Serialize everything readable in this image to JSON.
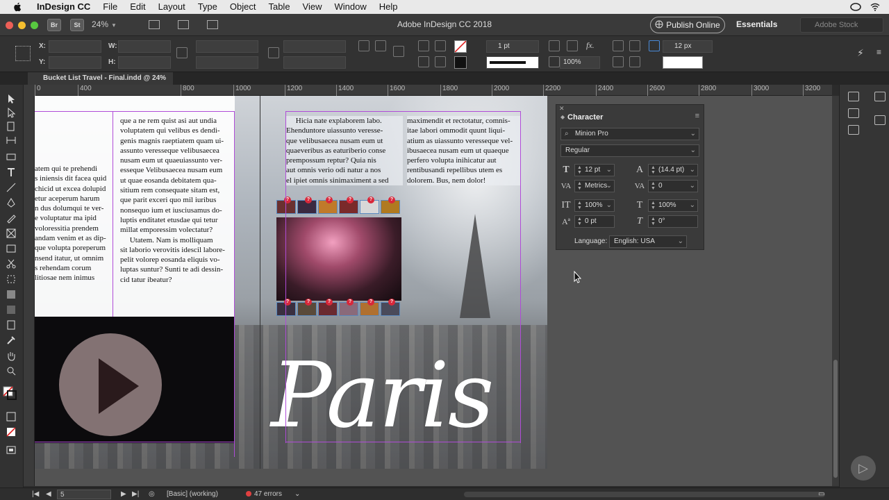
{
  "menubar": {
    "app_name": "InDesign CC",
    "items": [
      "File",
      "Edit",
      "Layout",
      "Type",
      "Object",
      "Table",
      "View",
      "Window",
      "Help"
    ]
  },
  "appbar": {
    "bridge_labels": [
      "Br",
      "St"
    ],
    "zoom": "24%",
    "title": "Adobe InDesign CC 2018",
    "publish_label": "Publish Online",
    "workspace": "Essentials",
    "stock_placeholder": "Adobe Stock"
  },
  "control_panel": {
    "x_label": "X:",
    "y_label": "Y:",
    "w_label": "W:",
    "h_label": "H:",
    "stroke_weight": "1 pt",
    "opacity": "100%",
    "gap": "12 px"
  },
  "document": {
    "tab_title": "Bucket List Travel - Final.indd @ 24%"
  },
  "ruler": {
    "ticks": [
      "0",
      "400",
      "800",
      "1000",
      "1200",
      "1400",
      "1600",
      "1800",
      "2000",
      "2200",
      "2400",
      "2600",
      "2800",
      "3000",
      "3200"
    ]
  },
  "page": {
    "left_col_a": "atem qui te prehendi\ns iniensis dit facea quid\nchicid ut excea dolupid\netur aceperum harum\nn dus dolumqui te ver-\ne voluptatur ma ipid\nvoloressitia prendem\nandam venim et as dip-\nque volupta poreperum\nnsend itatur, ut omnim\ns rehendam corum\nlitiosae nem inimus",
    "left_col_b": "que a ne rem quist asi aut undia\nvoluptatem qui velibus es dendi-\ngenis magnis raeptiatem quam ui-\nassunto veresseque velibusaecea\nnusam eum ut quaeuiassunto ver-\nesseque Velibusaecea nusam eum\nut quae eosanda debitatem qua-\nsitium rem consequate sitam est,\nque parit exceri quo mil iuribus\nnonsequo ium et iusciusamus do-\nluptis enditatet etusdae qui tetur\nmillat emporessim volectatur?\n     Utatem. Nam is molliquam\nsit laborio verovitis idescil labore-\npelit volorep eosanda eliquis vo-\nluptas suntur? Sunti te adi dessin-\ncid tatur ibeatur?",
    "right_col_a": "     Hicia nate explaborem labo.\nEhenduntore uiassunto veresse-\nque velibusaecea nusam eum ut\nquaeveribus as eaturiberio conse\nprempossum reptur? Quia nis\naut omnis verio odi natur a nos\nel ipiet omnis sinimaximent a sed",
    "right_col_b": "maximendit et rectotatur, comnis-\nitae labori ommodit quunt liqui-\natium as uiassunto veresseque vel-\nibusaecea nusam eum ut quaeque\nperfero volupta inihicatur aut\nrentibusandi repellibus utem es\ndolorem. Bus, nem dolor!",
    "headline": "Paris",
    "badge_mark": "?"
  },
  "character_panel": {
    "title": "Character",
    "font_family": "Minion Pro",
    "font_style": "Regular",
    "font_size": "12 pt",
    "leading": "(14.4 pt)",
    "kerning": "Metrics",
    "tracking": "0",
    "vertical_scale": "100%",
    "horizontal_scale": "100%",
    "baseline_shift": "0 pt",
    "skew": "0°",
    "language_label": "Language:",
    "language": "English: USA"
  },
  "statusbar": {
    "page_number": "5",
    "preflight_profile": "[Basic] (working)",
    "errors": "47 errors"
  },
  "colors": {
    "guide": "#b04bd8",
    "error": "#e04040",
    "badge": "#d8283a"
  }
}
